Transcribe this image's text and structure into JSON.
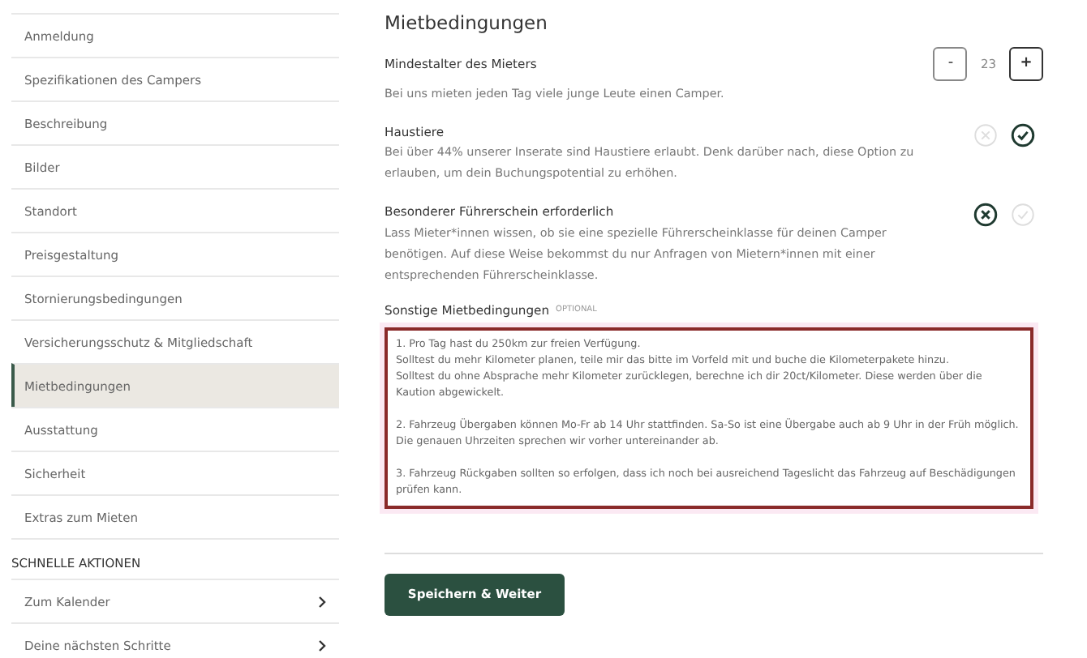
{
  "sidebar": {
    "items": [
      {
        "label": "Anmeldung",
        "selected": false
      },
      {
        "label": "Spezifikationen des Campers",
        "selected": false
      },
      {
        "label": "Beschreibung",
        "selected": false
      },
      {
        "label": "Bilder",
        "selected": false
      },
      {
        "label": "Standort",
        "selected": false
      },
      {
        "label": "Preisgestaltung",
        "selected": false
      },
      {
        "label": "Stornierungsbedingungen",
        "selected": false
      },
      {
        "label": "Versicherungsschutz & Mitgliedschaft",
        "selected": false
      },
      {
        "label": "Mietbedingungen",
        "selected": true
      },
      {
        "label": "Ausstattung",
        "selected": false
      },
      {
        "label": "Sicherheit",
        "selected": false
      },
      {
        "label": "Extras zum Mieten",
        "selected": false
      }
    ],
    "quick_actions": {
      "heading": "SCHNELLE AKTIONEN",
      "items": [
        {
          "label": "Zum Kalender"
        },
        {
          "label": "Deine nächsten Schritte"
        }
      ]
    }
  },
  "main": {
    "title": "Mietbedingungen",
    "min_age": {
      "label": "Mindestalter des Mieters",
      "description": "Bei uns mieten jeden Tag viele junge Leute einen Camper.",
      "minus": "-",
      "value": "23",
      "plus": "+"
    },
    "options": [
      {
        "label": "Haustiere",
        "description": "Bei über 44% unserer Inserate sind Haustiere erlaubt. Denk darüber nach, diese Option zu erlauben, um dein Buchungspotential zu erhöhen.",
        "allowed": true
      },
      {
        "label": "Besonderer Führerschein erforderlich",
        "description": "Lass Mieter*innen wissen, ob sie eine spezielle Führerscheinklasse für deinen Camper benötigen. Auf diese Weise bekommst du nur Anfragen von Mietern*innen mit einer entsprechenden Führerscheinklasse.",
        "allowed": false
      }
    ],
    "other": {
      "label": "Sonstige Mietbedingungen",
      "tag": "OPTIONAL",
      "value": "1. Pro Tag hast du 250km zur freien Verfügung.\nSolltest du mehr Kilometer planen, teile mir das bitte im Vorfeld mit und buche die Kilometerpakete hinzu.\nSolltest du ohne Absprache mehr Kilometer zurücklegen, berechne ich dir 20ct/Kilometer. Diese werden über die Kaution abgewickelt.\n\n2. Fahrzeug Übergaben können Mo-Fr ab 14 Uhr stattfinden. Sa-So ist eine Übergabe auch ab 9 Uhr in der Früh möglich. Die genauen Uhrzeiten sprechen wir vorher untereinander ab.\n\n3. Fahrzeug Rückgaben sollten so erfolgen, dass ich noch bei ausreichend Tageslicht das Fahrzeug auf Beschädigungen prüfen kann."
    },
    "save_button": "Speichern & Weiter"
  }
}
